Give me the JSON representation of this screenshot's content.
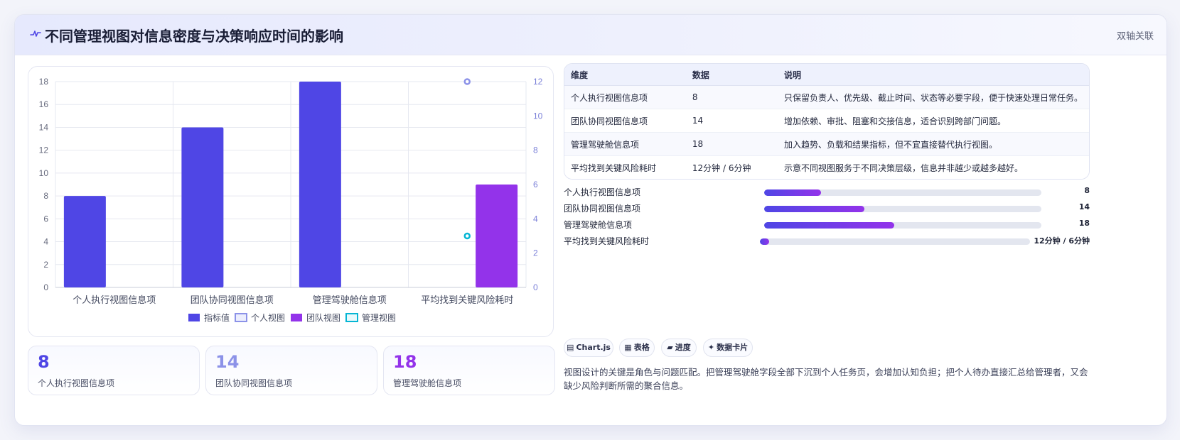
{
  "header": {
    "title": "不同管理视图对信息密度与决策响应时间的影响",
    "tag": "双轴关联",
    "icon": "pulse-icon"
  },
  "colors": {
    "indigo": "#4f46e5",
    "violet": "#9333ea",
    "lavender": "#8c92e8",
    "cyan": "#06b6d4",
    "grid": "#e6e8f0",
    "axis_right": "#7b80d8"
  },
  "chart_data": {
    "type": "bar",
    "categories": [
      "个人执行视图信息项",
      "团队协同视图信息项",
      "管理驾驶舱信息项",
      "平均找到关键风险耗时"
    ],
    "series": [
      {
        "name": "指标值",
        "type": "bar",
        "axis": "left",
        "values": [
          8,
          14,
          18,
          null
        ]
      },
      {
        "name": "个人视图",
        "type": "point",
        "axis": "right",
        "values": [
          null,
          null,
          null,
          12
        ]
      },
      {
        "name": "团队视图",
        "type": "bar",
        "axis": "right",
        "values": [
          null,
          null,
          null,
          6
        ]
      },
      {
        "name": "管理视图",
        "type": "point",
        "axis": "right",
        "values": [
          null,
          null,
          null,
          3
        ]
      }
    ],
    "y_left": {
      "min": 0,
      "max": 18,
      "ticks": [
        "0",
        "2",
        "4",
        "6",
        "8",
        "10",
        "12",
        "14",
        "16",
        "18"
      ]
    },
    "y_right": {
      "min": 0,
      "max": 12,
      "ticks": [
        "0",
        "2",
        "4",
        "6",
        "8",
        "10",
        "12"
      ]
    },
    "grid": true,
    "legend_position": "bottom"
  },
  "stats": [
    {
      "value": "8",
      "label": "个人执行视图信息项",
      "color": "#4f46e5"
    },
    {
      "value": "14",
      "label": "团队协同视图信息项",
      "color": "#8c92e8"
    },
    {
      "value": "18",
      "label": "管理驾驶舱信息项",
      "color": "#9333ea"
    }
  ],
  "table": {
    "headers": [
      "维度",
      "数据",
      "说明"
    ],
    "rows": [
      [
        "个人执行视图信息项",
        "8",
        "只保留负责人、优先级、截止时间、状态等必要字段，便于快速处理日常任务。"
      ],
      [
        "团队协同视图信息项",
        "14",
        "增加依赖、审批、阻塞和交接信息，适合识别跨部门问题。"
      ],
      [
        "管理驾驶舱信息项",
        "18",
        "加入趋势、负载和结果指标，但不宜直接替代执行视图。"
      ],
      [
        "平均找到关键风险耗时",
        "12分钟 / 6分钟",
        "示意不同视图服务于不同决策层级，信息并非越少或越多越好。"
      ]
    ]
  },
  "progress": [
    {
      "label": "个人执行视图信息项",
      "value": "8",
      "fraction": 0.2051
    },
    {
      "label": "团队协同视图信息项",
      "value": "14",
      "fraction": 0.3615
    },
    {
      "label": "管理驾驶舱信息项",
      "value": "18",
      "fraction": 0.4692
    },
    {
      "label": "平均找到关键风险耗时",
      "value": "12分钟 / 6分钟",
      "fraction": 0.035
    }
  ],
  "chips": [
    {
      "icon": "chart-icon",
      "glyph": "▤",
      "label": "Chart.js"
    },
    {
      "icon": "table-icon",
      "glyph": "▦",
      "label": "表格"
    },
    {
      "icon": "progress-icon",
      "glyph": "▰",
      "label": "进度"
    },
    {
      "icon": "sparkle-icon",
      "glyph": "✦",
      "label": "数据卡片"
    }
  ],
  "note": "视图设计的关键是角色与问题匹配。把管理驾驶舱字段全部下沉到个人任务页，会增加认知负担；把个人待办直接汇总给管理者，又会缺少风险判断所需的聚合信息。"
}
